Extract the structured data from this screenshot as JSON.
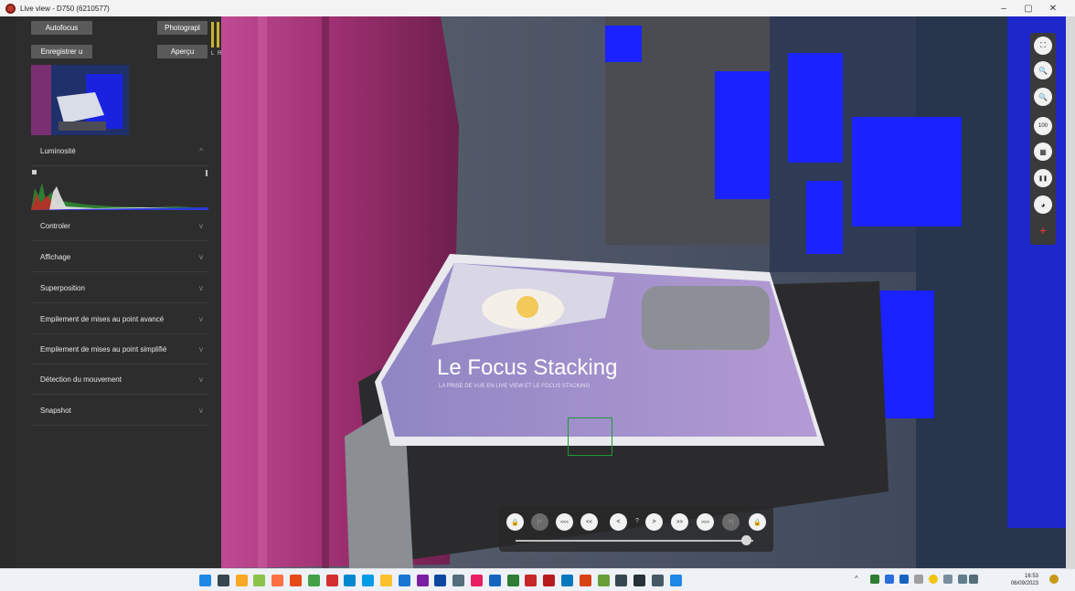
{
  "window": {
    "title": "Live view - D750 (6210577)",
    "controls": [
      "–",
      "▢",
      "✕"
    ]
  },
  "left_panel": {
    "buttons": {
      "autofocus": "Autofocus",
      "photograph": "Photograpl",
      "record": "Enregistrer u",
      "preview": "Aperçu"
    },
    "meter_labels": {
      "l": "L",
      "r": "R"
    },
    "sections": [
      {
        "label": "Luminosité",
        "chevron": "^"
      },
      {
        "label": "Controler",
        "chevron": "v"
      },
      {
        "label": "Affichage",
        "chevron": "v"
      },
      {
        "label": "Superposition",
        "chevron": "v"
      },
      {
        "label": "Empilement de mises au point avancé",
        "chevron": "v"
      },
      {
        "label": "Empilement de mises au point simplifié",
        "chevron": "v"
      },
      {
        "label": "Détection du mouvement",
        "chevron": "v"
      },
      {
        "label": "Snapshot",
        "chevron": "v"
      }
    ],
    "side_handle": "⋮"
  },
  "live_view": {
    "pamphlet_title": "Le Focus Stacking",
    "pamphlet_subtitle": "LA PRISE DE VUE EN LIVE VIEW ET LE FOCUS STACKING"
  },
  "right_tools": [
    {
      "icon": "fullscreen-icon",
      "glyph": "⛶"
    },
    {
      "icon": "zoom-out-icon",
      "glyph": "🔍"
    },
    {
      "icon": "zoom-in-icon",
      "glyph": "🔍"
    },
    {
      "icon": "zoom-100-icon",
      "glyph": "100"
    },
    {
      "icon": "grid-icon",
      "glyph": "▦"
    },
    {
      "icon": "pause-icon",
      "glyph": "❚❚"
    },
    {
      "icon": "aperture-icon",
      "glyph": "◕"
    },
    {
      "icon": "crosshair-icon",
      "glyph": "+"
    }
  ],
  "playback": {
    "buttons": [
      {
        "icon": "lock-icon",
        "glyph": "🔒",
        "enabled": true
      },
      {
        "icon": "first-icon",
        "glyph": "|<",
        "enabled": false
      },
      {
        "icon": "rewind-fast-icon",
        "glyph": "<<<",
        "enabled": true
      },
      {
        "icon": "rewind-icon",
        "glyph": "<<",
        "enabled": true
      },
      {
        "icon": "step-back-icon",
        "glyph": "<",
        "enabled": true
      },
      {
        "icon": "step-forward-icon",
        "glyph": ">",
        "enabled": true
      },
      {
        "icon": "forward-icon",
        "glyph": ">>",
        "enabled": true
      },
      {
        "icon": "forward-fast-icon",
        "glyph": ">>>",
        "enabled": true
      },
      {
        "icon": "last-icon",
        "glyph": ">|",
        "enabled": false
      },
      {
        "icon": "lock-icon",
        "glyph": "🔒",
        "enabled": true
      }
    ],
    "position_label": "?",
    "slider_value": 0.97
  },
  "taskbar": {
    "time": "16:53",
    "date": "06/09/2023",
    "icons": [
      "start-icon",
      "task-view-icon",
      "file-explorer-icon",
      "chrome-icon",
      "firefox-icon",
      "brave-icon",
      "chrome-canary-icon",
      "opera-icon",
      "edge-icon",
      "telegram-icon",
      "sticky-notes-icon",
      "notepad-icon",
      "onenote-icon",
      "photoshop-icon",
      "photo-icon",
      "paint-icon",
      "word-icon",
      "excel-icon",
      "powerpoint-icon",
      "access-icon",
      "outlook-icon",
      "filezilla-icon",
      "image-viewer-icon",
      "camera-app-icon",
      "camera-icon",
      "capture-icon",
      "live-view-icon"
    ]
  },
  "colors": {
    "panel_bg": "#2d2d2d",
    "button_bg": "#5a5a5a",
    "focus_box": "#1e9a34",
    "overexposure_blue": "#1a22ff",
    "magenta_curtain": "#b53a86"
  }
}
